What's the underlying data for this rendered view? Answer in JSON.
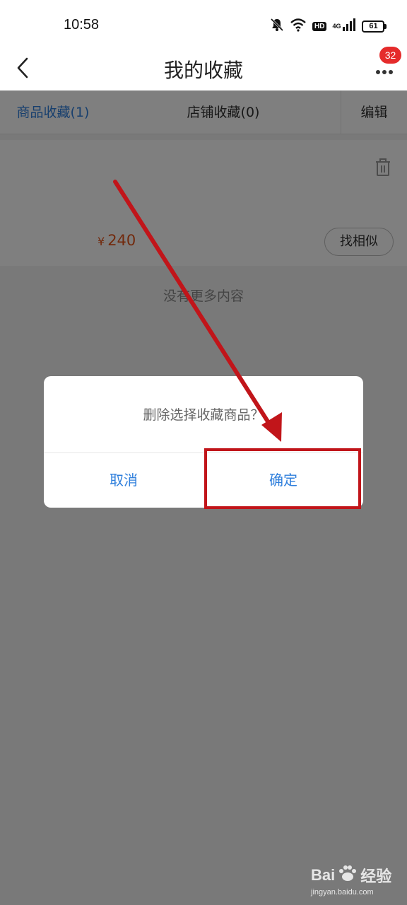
{
  "status_bar": {
    "time": "10:58",
    "network": "4G",
    "hd": "HD",
    "battery": "61"
  },
  "nav": {
    "title": "我的收藏",
    "badge": "32"
  },
  "tabs": {
    "goods": "商品收藏(1)",
    "stores": "店铺收藏(0)",
    "edit": "编辑"
  },
  "item": {
    "currency": "¥",
    "price": "240",
    "find_similar": "找相似"
  },
  "list_footer": "没有更多内容",
  "dialog": {
    "message": "删除选择收藏商品？",
    "cancel": "取消",
    "confirm": "确定"
  },
  "watermark": {
    "brand": "Bai",
    "brand_suffix": "经验",
    "url": "jingyan.baidu.com"
  },
  "colors": {
    "accent": "#2f7fdc",
    "price": "#e5551a",
    "badge": "#e52b2b",
    "annotation": "#c1151a"
  },
  "icons": [
    "bell-off-icon",
    "wifi-icon",
    "signal-icon",
    "battery-icon",
    "back-arrow-icon",
    "more-dots-icon",
    "trash-icon",
    "paw-icon"
  ]
}
